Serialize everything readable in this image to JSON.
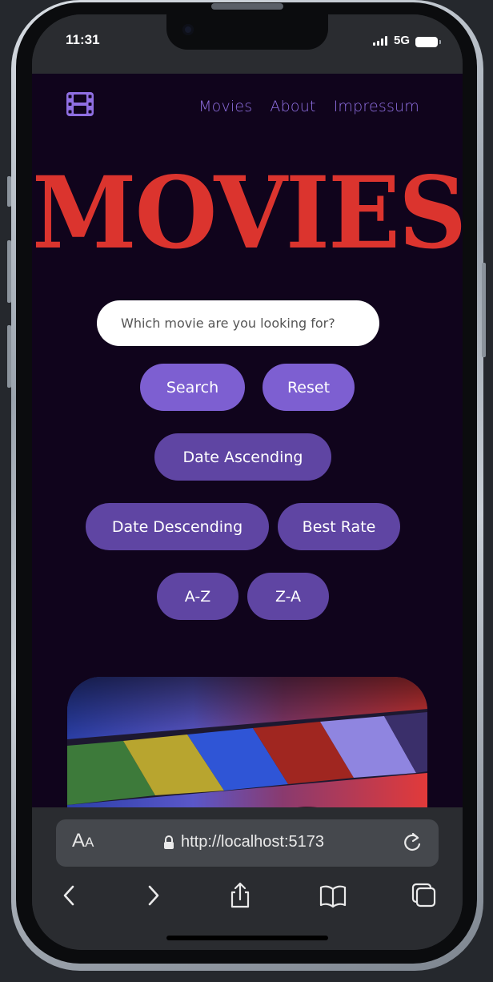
{
  "status_bar": {
    "time": "11:31",
    "network": "5G"
  },
  "nav": {
    "logo_icon": "film-strip-icon",
    "links": [
      "Movies",
      "About",
      "Impressum"
    ]
  },
  "hero": {
    "title": "MOVIES",
    "title_color": "#db342e"
  },
  "search": {
    "placeholder": "Which movie are you looking for?",
    "value": ""
  },
  "buttons": {
    "search": "Search",
    "reset": "Reset",
    "date_ascending": "Date Ascending",
    "date_descending": "Date Descending",
    "best_rate": "Best Rate",
    "a_z": "A-Z",
    "z_a": "Z-A"
  },
  "colors": {
    "page_background": "#10041c",
    "accent": "#8f6fe2",
    "button_primary": "#7d5fd1",
    "button_secondary": "#5f45a3"
  },
  "browser": {
    "text_size_label_big": "A",
    "text_size_label_small": "A",
    "url": "http://localhost:5173",
    "icons": [
      "back-icon",
      "forward-icon",
      "share-icon",
      "bookmarks-icon",
      "tabs-icon"
    ]
  }
}
